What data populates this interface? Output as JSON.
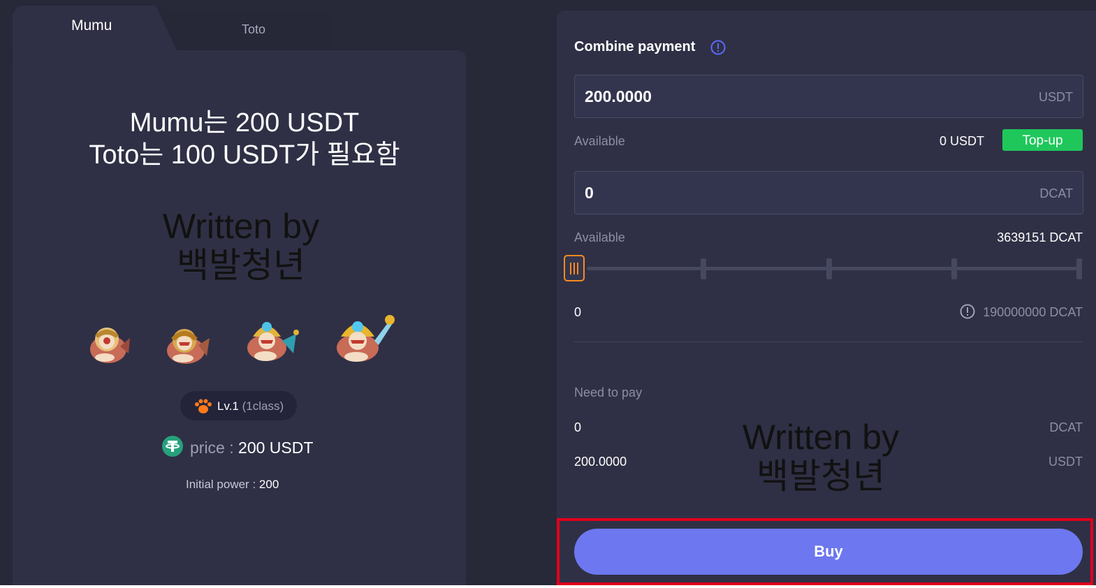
{
  "tabs": [
    {
      "label": "Mumu",
      "active": true
    },
    {
      "label": "Toto",
      "active": false
    }
  ],
  "overlay_note": {
    "line1": "Mumu는 200 USDT",
    "line2": "Toto는 100 USDT가 필요함"
  },
  "watermark": {
    "line1": "Written by",
    "line2": "백발청년"
  },
  "characters": [
    "mumu-stage-1",
    "mumu-stage-2",
    "mumu-stage-3",
    "mumu-stage-4"
  ],
  "level": {
    "label": "Lv.1",
    "sub": "(1class)"
  },
  "price": {
    "label": "price",
    "separator": ":",
    "value": "200 USDT"
  },
  "power": {
    "label": "Initial power",
    "separator": ":",
    "value": "200"
  },
  "combine": {
    "title": "Combine payment"
  },
  "usdt_input": {
    "value": "200.0000",
    "unit": "USDT"
  },
  "usdt_available": {
    "label": "Available",
    "value": "0 USDT",
    "topup_label": "Top-up"
  },
  "dcat_input": {
    "value": "0",
    "unit": "DCAT"
  },
  "dcat_available": {
    "label": "Available",
    "value": "3639151 DCAT"
  },
  "slider": {
    "min_label": "0",
    "max_label": "190000000 DCAT",
    "value_fraction": 0
  },
  "need_to_pay": {
    "label": "Need to pay",
    "dcat_value": "0",
    "dcat_unit": "DCAT",
    "usdt_value": "200.0000",
    "usdt_unit": "USDT"
  },
  "buy": {
    "label": "Buy"
  },
  "colors": {
    "background": "#272838",
    "panel": "#2f3045",
    "accent_button": "#6d77f0",
    "topup_green": "#1fc75b",
    "slider_orange": "#ff8a1f",
    "highlight_red": "#e0001b",
    "info_blue": "#5b6bff"
  },
  "icons": [
    "info-icon",
    "paw-icon",
    "tether-icon",
    "alert-icon"
  ]
}
